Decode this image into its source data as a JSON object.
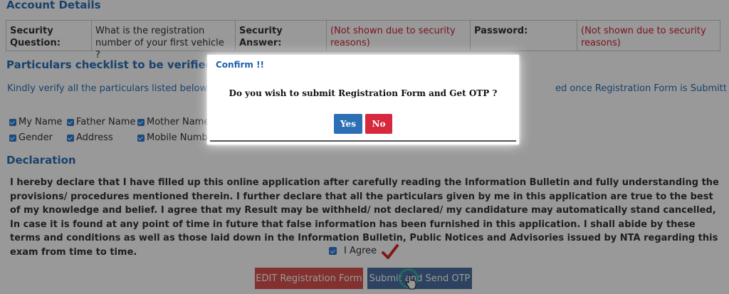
{
  "account": {
    "heading": "Account Details",
    "security_question_label": "Security Question:",
    "security_question_value": "What is the registration number of your first vehicle ?",
    "security_answer_label": "Security Answer:",
    "security_answer_value": "(Not shown due to security reasons)",
    "password_label": "Password:",
    "password_value": "(Not shown due to security reasons)"
  },
  "checklist": {
    "heading": "Particulars checklist to be verified",
    "instruction_left": "Kindly verify all the particulars listed below caref",
    "instruction_right": "ed once Registration Form is Submitted or at any",
    "items": [
      "My Name",
      "Father Name",
      "Mother Name",
      "Gender",
      "Address",
      "Mobile Numbe"
    ]
  },
  "declaration": {
    "heading": "Declaration",
    "text": "I hereby declare that I have filled up this online application after carefully reading the Information Bulletin and fully understanding the provisions/ procedures mentioned therein. I further declare that all the particulars given by me in this application are true to the best of my knowledge and belief. I agree that my Result may be withheld/ not declared/ my candidature may automatically stand cancelled, In case it is found at any point of time in future that false information has been furnished in this application. I shall abide by these terms and conditions as well as those laid down in the Information Bulletin, Public Notices and Advisories issued by NTA regarding this exam from time to time.",
    "agree_label": "I Agree"
  },
  "actions": {
    "edit_label": "EDIT Registration Form",
    "submit_label": "Submit and Send OTP"
  },
  "modal": {
    "title": "Confirm !!",
    "message": "Do you wish to submit Registration Form and Get OTP ?",
    "yes_label": "Yes",
    "no_label": "No"
  },
  "colors": {
    "heading_blue": "#2a6fb8",
    "error_red": "#cc2233",
    "edit_button": "#d9534f",
    "submit_button": "#4a6fa0",
    "yes_button": "#2c6fb5",
    "no_button": "#d7283e"
  },
  "icons": [
    "checkbox-checked-icon",
    "red-tick-icon",
    "pointer-cursor-icon"
  ]
}
